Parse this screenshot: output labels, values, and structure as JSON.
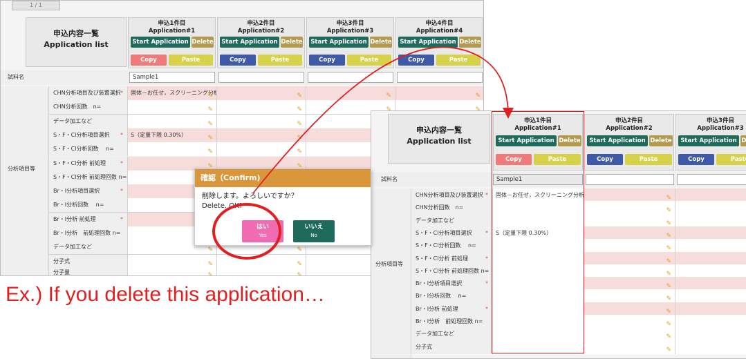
{
  "left_panel": {
    "pager": "1 / 1",
    "header": {
      "title_jp": "申込内容一覧",
      "title_en": "Application list"
    },
    "apps": [
      {
        "title_jp": "申込1件目",
        "title_en": "Application#1",
        "start": "Start Application",
        "delete": "Delete",
        "copy": "Copy",
        "paste": "Paste"
      },
      {
        "title_jp": "申込2件目",
        "title_en": "Application#2",
        "start": "Start Application",
        "delete": "Delete",
        "copy": "Copy",
        "paste": "Paste"
      },
      {
        "title_jp": "申込3件目",
        "title_en": "Application#3",
        "start": "Start Application",
        "delete": "Delete",
        "copy": "Copy",
        "paste": "Paste"
      },
      {
        "title_jp": "申込4件目",
        "title_en": "Application#4",
        "start": "Start Application",
        "delete": "Delete",
        "copy": "Copy",
        "paste": "Paste"
      }
    ],
    "sample_label": "試料名",
    "sample_value": "Sample1",
    "group_label": "分析項目等",
    "rows": [
      {
        "label": "CHN分析項目及び装置選択",
        "required": "*",
        "value": "固体－お任せ，スクリーニング分析"
      },
      {
        "label": "CHN分析回数　n=",
        "required": "",
        "value": ""
      },
      {
        "label": "データ加工など",
        "required": "",
        "value": ""
      },
      {
        "label": "S・F・Cl分析項目選択",
        "required": "*",
        "value": "S（定量下限 0.30%）"
      },
      {
        "label": "S・F・Cl分析回数　 n=",
        "required": "",
        "value": ""
      },
      {
        "label": "S・F・Cl分析 前処理",
        "required": "*",
        "value": ""
      },
      {
        "label": "S・F・Cl分析 前処理回数 n=",
        "required": "",
        "value": ""
      },
      {
        "label": "Br・I分析項目選択",
        "required": "*",
        "value": ""
      },
      {
        "label": "Br・I分析回数　 n=",
        "required": "",
        "value": ""
      },
      {
        "label": "Br・I分析 前処理",
        "required": "*",
        "value": ""
      },
      {
        "label": "Br・I分析　前処理回数 n=",
        "required": "",
        "value": ""
      },
      {
        "label": "データ加工など",
        "required": "",
        "value": ""
      }
    ],
    "extra_rows": [
      {
        "label": "分子式"
      },
      {
        "label": "分子量"
      }
    ]
  },
  "dialog": {
    "title": "確認（Confirm)",
    "message_jp": "削除します。よろしいですか？",
    "message_en": "Delete. OK?",
    "yes_jp": "はい",
    "yes_en": "Yes",
    "no_jp": "いいえ",
    "no_en": "No"
  },
  "caption": "Ex.) If you delete this application…",
  "right_panel": {
    "header": {
      "title_jp": "申込内容一覧",
      "title_en": "Application list"
    },
    "apps": [
      {
        "title_jp": "申込1件目",
        "title_en": "Application#1",
        "start": "Start Application",
        "delete": "Delete",
        "copy": "Copy",
        "paste": "Paste"
      },
      {
        "title_jp": "申込2件目",
        "title_en": "Application#2",
        "start": "Start Application",
        "delete": "Delete",
        "copy": "Copy",
        "paste": "Paste"
      },
      {
        "title_jp": "申込3件目",
        "title_en": "Application#3",
        "start": "Start Application",
        "delete": "Delete",
        "copy": "Copy",
        "paste": "Paste"
      }
    ],
    "sample_label": "試料名",
    "sample_value": "Sample1",
    "group_label": "分析項目等",
    "rows": [
      {
        "label": "CHN分析項目及び装置選択",
        "required": "*",
        "value": "固体－お任せ，スクリーニング分析"
      },
      {
        "label": "CHN分析回数　n=",
        "required": "",
        "value": ""
      },
      {
        "label": "データ加工など",
        "required": "",
        "value": ""
      },
      {
        "label": "S・F・Cl分析項目選択",
        "required": "*",
        "value": "S（定量下限 0.30%）"
      },
      {
        "label": "S・F・Cl分析回数　 n=",
        "required": "",
        "value": ""
      },
      {
        "label": "S・F・Cl分析 前処理",
        "required": "*",
        "value": ""
      },
      {
        "label": "S・F・Cl分析 前処理回数 n=",
        "required": "",
        "value": ""
      },
      {
        "label": "Br・I分析項目選択",
        "required": "*",
        "value": ""
      },
      {
        "label": "Br・I分析回数　 n=",
        "required": "",
        "value": ""
      },
      {
        "label": "Br・I分析 前処理",
        "required": "*",
        "value": ""
      },
      {
        "label": "Br・I分析　前処理回数 n=",
        "required": "",
        "value": ""
      },
      {
        "label": "データ加工など",
        "required": "",
        "value": ""
      }
    ],
    "extra_rows": [
      {
        "label": "分子式"
      }
    ]
  },
  "colors": {
    "start": "#1e6b5b",
    "delete": "#b59a4e",
    "copy": "#3f5aa8",
    "copy_active": "#f07a7a",
    "paste": "#d7d24a",
    "dialog_header": "#d9963b",
    "yes": "#f06bb2",
    "annotation": "#e02020"
  },
  "icons": {
    "edit": "pencil-icon"
  }
}
